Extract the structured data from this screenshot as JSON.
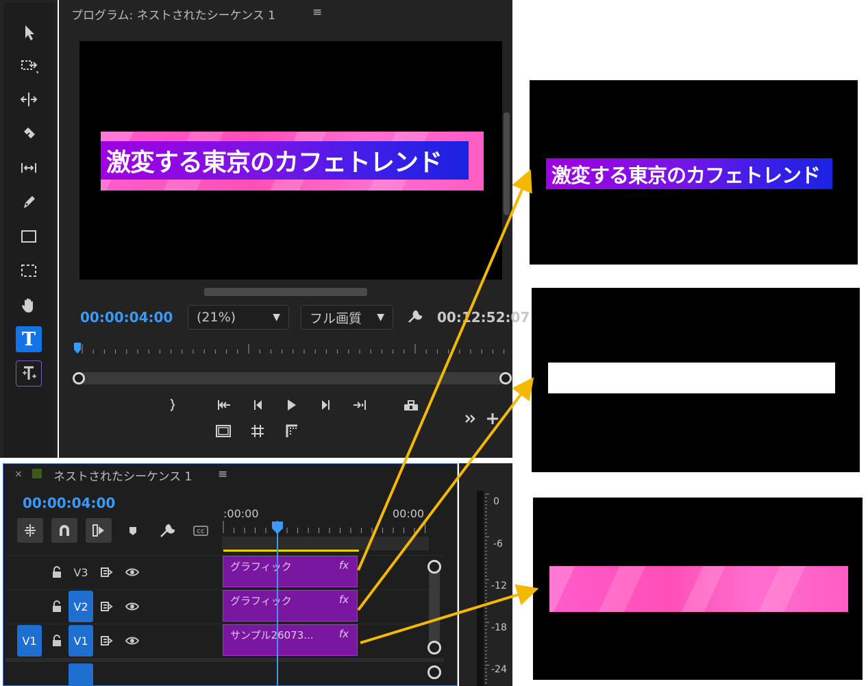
{
  "program": {
    "title": "プログラム: ネストされたシーケンス 1",
    "menu": "≡",
    "banner_text": "激変する東京のカフェトレンド",
    "timecode_current": "00:00:04:00",
    "zoom": "(21%)",
    "quality": "フル画質",
    "timecode_duration": "00:12:52:07"
  },
  "tools": [
    "selection-tool",
    "track-select-tool",
    "ripple-edit-tool",
    "razor-tool",
    "slip-tool",
    "pen-tool",
    "rectangle-tool",
    "marquee-tool",
    "hand-tool",
    "type-tool",
    "vertical-type-tool"
  ],
  "type_tool_label": "T",
  "timeline": {
    "close": "×",
    "title": "ネストされたシーケンス 1",
    "menu": "≡",
    "timecode": "00:00:04:00",
    "ruler_start": ":00:00",
    "ruler_end": "00:00",
    "tracks": [
      {
        "label": "V3",
        "source": "",
        "clip": "グラフィック",
        "fx": "fx"
      },
      {
        "label": "V2",
        "source": "",
        "clip": "グラフィック",
        "fx": "fx"
      },
      {
        "label": "V1",
        "source": "V1",
        "clip": "サンプル26073...",
        "fx": "fx"
      }
    ]
  },
  "meter": {
    "labels": [
      "0",
      "-6",
      "-12",
      "-18",
      "-24"
    ]
  },
  "previews": {
    "top_text": "激変する東京のカフェトレンド"
  },
  "colors": {
    "accent": "#1473e6",
    "timecode": "#3b9af8",
    "clip": "#7a17a0",
    "arrow": "#f5b800"
  }
}
